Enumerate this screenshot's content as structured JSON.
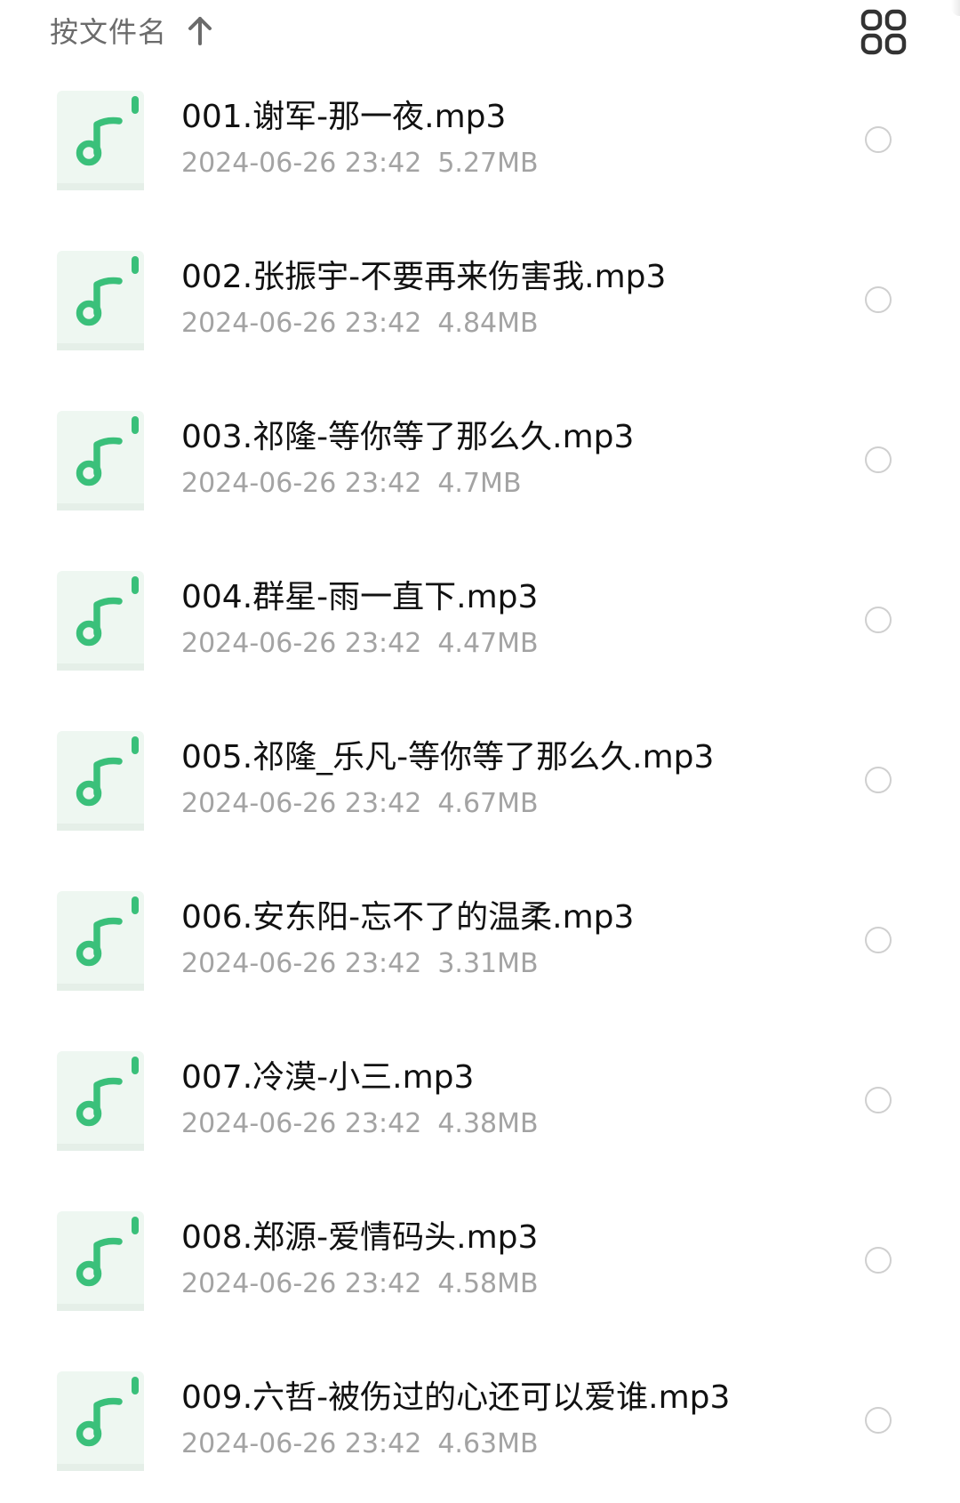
{
  "toolbar": {
    "sort_label": "按文件名",
    "sort_direction_icon": "arrow-up-icon",
    "view_toggle_icon": "grid-view-icon"
  },
  "colors": {
    "accent": "#3ac07a",
    "icon_bg": "#eef7f1",
    "primary_text": "#111111",
    "secondary_text": "#a3a3a3",
    "checkbox_border": "#cfcfcf"
  },
  "files": [
    {
      "name": "001.谢军-那一夜.mp3",
      "date": "2024-06-26 23:42",
      "size": "5.27MB",
      "icon": "music-note-icon"
    },
    {
      "name": "002.张振宇-不要再来伤害我.mp3",
      "date": "2024-06-26 23:42",
      "size": "4.84MB",
      "icon": "music-note-icon"
    },
    {
      "name": "003.祁隆-等你等了那么久.mp3",
      "date": "2024-06-26 23:42",
      "size": "4.7MB",
      "icon": "music-note-icon"
    },
    {
      "name": "004.群星-雨一直下.mp3",
      "date": "2024-06-26 23:42",
      "size": "4.47MB",
      "icon": "music-note-icon"
    },
    {
      "name": "005.祁隆_乐凡-等你等了那么久.mp3",
      "date": "2024-06-26 23:42",
      "size": "4.67MB",
      "icon": "music-note-icon"
    },
    {
      "name": "006.安东阳-忘不了的温柔.mp3",
      "date": "2024-06-26 23:42",
      "size": "3.31MB",
      "icon": "music-note-icon"
    },
    {
      "name": "007.冷漠-小三.mp3",
      "date": "2024-06-26 23:42",
      "size": "4.38MB",
      "icon": "music-note-icon"
    },
    {
      "name": "008.郑源-爱情码头.mp3",
      "date": "2024-06-26 23:42",
      "size": "4.58MB",
      "icon": "music-note-icon"
    },
    {
      "name": "009.六哲-被伤过的心还可以爱谁.mp3",
      "date": "2024-06-26 23:42",
      "size": "4.63MB",
      "icon": "music-note-icon"
    }
  ]
}
